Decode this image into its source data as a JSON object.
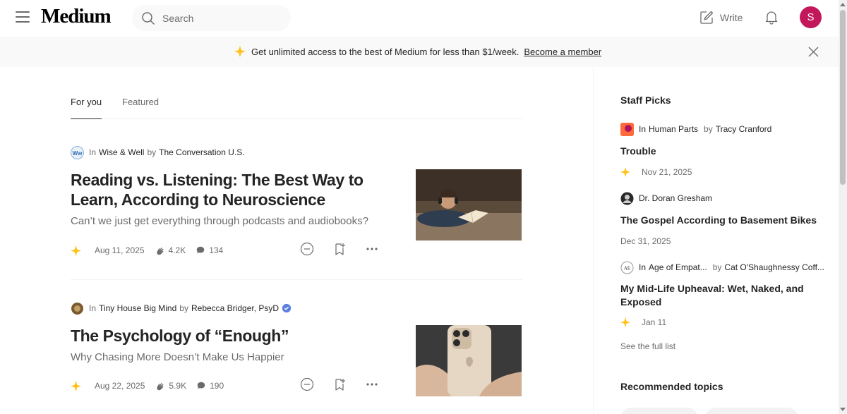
{
  "header": {
    "logo": "Medium",
    "search_placeholder": "Search",
    "write_label": "Write",
    "avatar_initial": "S"
  },
  "banner": {
    "text": "Get unlimited access to the best of Medium for less than $1/week.",
    "link": "Become a member"
  },
  "tabs": [
    {
      "label": "For you",
      "active": true
    },
    {
      "label": "Featured",
      "active": false
    }
  ],
  "articles": [
    {
      "in_label": "In",
      "publication": "Wise & Well",
      "by_label": "by",
      "author": "The Conversation U.S.",
      "title": "Reading vs. Listening: The Best Way to Learn, According to Neuroscience",
      "subtitle": "Can’t we just get everything through podcasts and audiobooks?",
      "date": "Aug 11, 2025",
      "claps": "4.2K",
      "comments": "134"
    },
    {
      "in_label": "In",
      "publication": "Tiny House Big Mind",
      "by_label": "by",
      "author": "Rebecca Bridger, PsyD",
      "title": "The Psychology of “Enough”",
      "subtitle": "Why Chasing More Doesn’t Make Us Happier",
      "date": "Aug 22, 2025",
      "claps": "5.9K",
      "comments": "190"
    }
  ],
  "sidebar": {
    "staff_picks_heading": "Staff Picks",
    "picks": [
      {
        "in_label": "In",
        "publication": "Human Parts",
        "by_label": "by",
        "author": "Tracy Cranford",
        "title": "Trouble",
        "date": "Nov 21, 2025"
      },
      {
        "author": "Dr. Doran Gresham",
        "title": "The Gospel According to Basement Bikes",
        "date": "Dec 31, 2025"
      },
      {
        "in_label": "In",
        "publication": "Age of Empat...",
        "by_label": "by",
        "author": "Cat O'Shaughnessy Coff...",
        "title": "My Mid-Life Upheaval: Wet, Naked, and Exposed",
        "date": "Jan 11"
      }
    ],
    "full_list_label": "See the full list",
    "recommended_heading": "Recommended topics"
  },
  "colors": {
    "accent_star": "#FFC017",
    "avatar_bg": "#C2185B",
    "text_primary": "#242424",
    "text_muted": "#6B6B6B"
  }
}
